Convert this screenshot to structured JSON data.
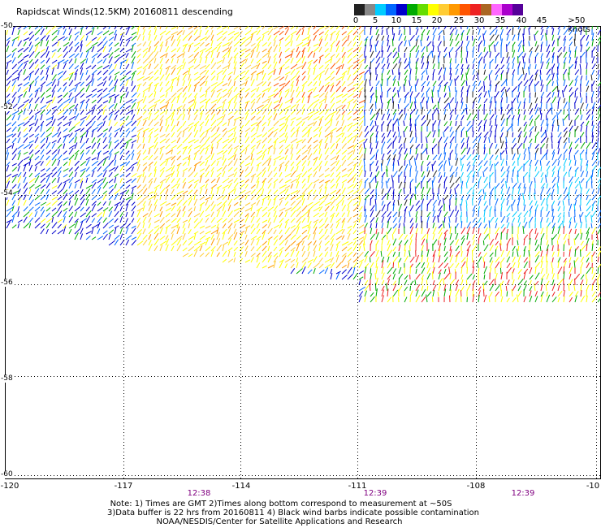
{
  "title": "Rapidscat Winds(12.5KM) 20160811 descending",
  "legend": {
    "colors": [
      "#222222",
      "#888888",
      "#00ccff",
      "#0066ff",
      "#0000cc",
      "#00aa00",
      "#66dd00",
      "#ffff00",
      "#ffcc33",
      "#ff9900",
      "#ff5500",
      "#ee2222",
      "#aa6622",
      "#ff66ff",
      "#aa00cc",
      "#550099"
    ],
    "labels": [
      "0",
      "5",
      "10",
      "15",
      "20",
      "25",
      "30",
      "35",
      "40",
      "45",
      ">50 knots"
    ]
  },
  "lat_labels": [
    "-50",
    "-52",
    "-54",
    "-56",
    "-58",
    "-60"
  ],
  "lon_labels": [
    "-120",
    "-117",
    "-114",
    "-111",
    "-108",
    "-10"
  ],
  "time_labels": [
    "12:38",
    "12:39",
    "12:39"
  ],
  "notes": [
    "Note: 1) Times are GMT 2)Times along bottom correspond to measurement at ~50S",
    "3)Data buffer is 22 hrs from 20160811 4) Black wind barbs indicate possible contamination",
    "NOAA/NESDIS/Center for Satellite Applications and Research"
  ]
}
